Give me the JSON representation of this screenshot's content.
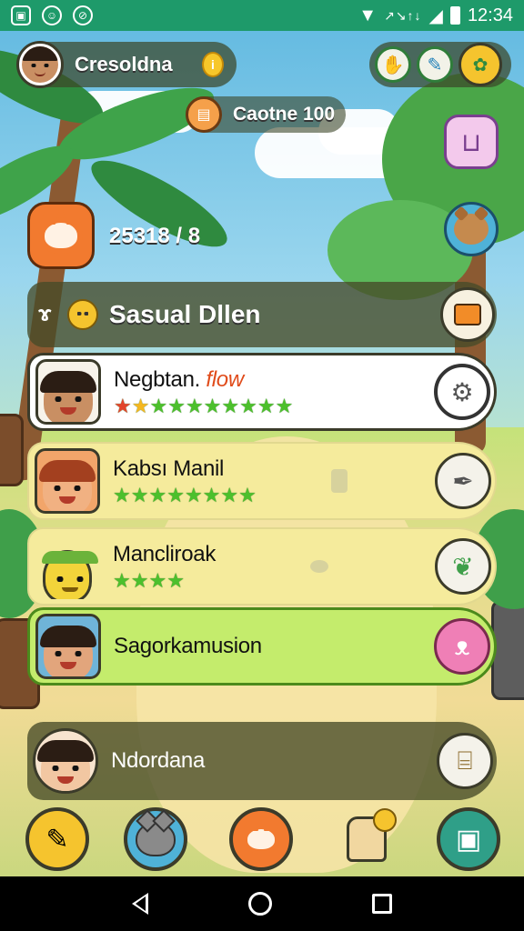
{
  "status_bar": {
    "time": "12:34",
    "signal_text": "↗↘↑↓",
    "left_icons": [
      "image-icon",
      "face-icon",
      "blocked-icon"
    ],
    "right_icons": [
      "wifi-icon",
      "cell-signal-icon",
      "battery-icon"
    ]
  },
  "player": {
    "name": "Cresoldna",
    "coin_symbol": "i"
  },
  "hud_actions": [
    "hand-icon",
    "pencil-icon",
    "map-icon"
  ],
  "currency": {
    "label": "Caotne 100"
  },
  "side_buttons": [
    "basket-icon",
    "pet-icon"
  ],
  "score_text": "25318 / 8",
  "list_header": {
    "title": "Sasual Dllen",
    "button_icon": "notes-icon"
  },
  "rows": [
    {
      "name": "Negbtan.",
      "name_accent": "flow",
      "stars": [
        "red",
        "gold",
        "green",
        "green",
        "green",
        "green",
        "green",
        "green",
        "green",
        "green"
      ],
      "action_icon": "gear-icon",
      "highlight": "white"
    },
    {
      "name": "Kabsı Manil",
      "stars": [
        "green",
        "green",
        "green",
        "green",
        "green",
        "green",
        "green",
        "green"
      ],
      "action_icon": "feather-icon",
      "highlight": "yellow"
    },
    {
      "name": "Mancliroak",
      "stars": [
        "green",
        "green",
        "green",
        "green"
      ],
      "action_icon": "leaf-icon",
      "highlight": "yellow"
    },
    {
      "name": "Sagorkamusion",
      "stars": [],
      "action_icon": "pink-pet-icon",
      "highlight": "lime"
    },
    {
      "name": "Ndordana",
      "stars": [],
      "action_icon": "log-icon",
      "highlight": "dark"
    }
  ],
  "dock": [
    "pencil-tool-icon",
    "cat-icon",
    "fox-icon",
    "toast-character-icon",
    "book-icon"
  ],
  "nav": [
    "back-icon",
    "home-icon",
    "recents-icon"
  ],
  "colors": {
    "status_bar": "#1e9a6a",
    "panel_dark": "#464a28",
    "row_yellow": "#f5eb9c",
    "row_lime": "#c4ec6c",
    "star_green": "#4cc02c",
    "accent_orange": "#f27a2f"
  }
}
